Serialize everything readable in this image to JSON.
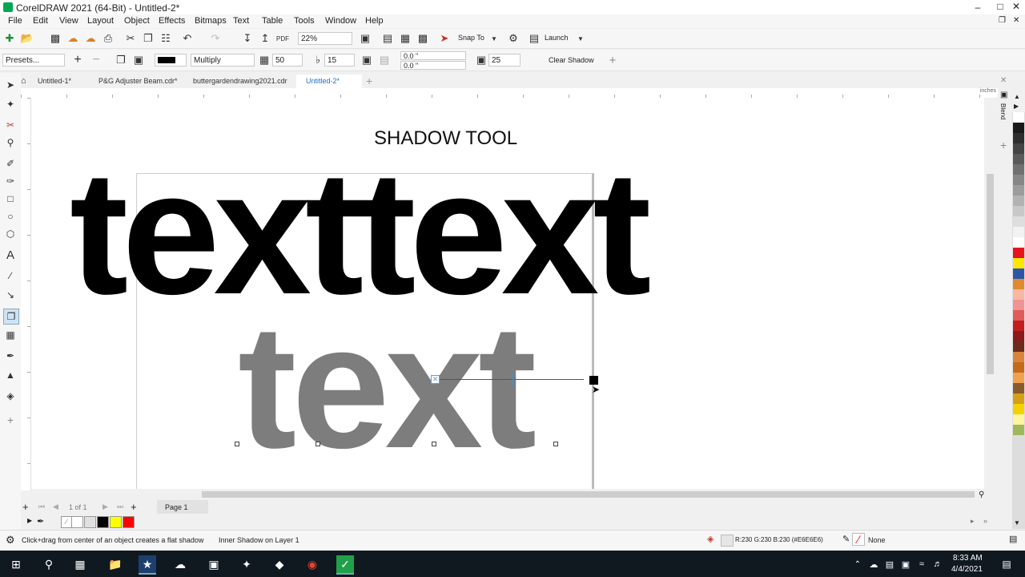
{
  "window": {
    "title": "CorelDRAW 2021 (64-Bit) - Untitled-2*"
  },
  "menu": [
    "File",
    "Edit",
    "View",
    "Layout",
    "Object",
    "Effects",
    "Bitmaps",
    "Text",
    "Table",
    "Tools",
    "Window",
    "Help"
  ],
  "standard_toolbar": {
    "zoom": "22%",
    "snap_to": "Snap To",
    "launch": "Launch"
  },
  "property_bar": {
    "presets": "Presets...",
    "merge_mode": "Multiply",
    "opacity": "50",
    "feather": "15",
    "offset_x": "0.0 \"",
    "offset_y": "0.0 \"",
    "shadow_stretch": "25",
    "clear_shadow": "Clear Shadow"
  },
  "doc_tabs": [
    "Untitled-1*",
    "P&G Adjuster Beam.cdr*",
    "buttergardendrawing2021.cdr",
    "Untitled-2*"
  ],
  "active_tab": "Untitled-2*",
  "ruler": {
    "unit": "inches"
  },
  "canvas": {
    "heading": "SHADOW TOOL",
    "word_line_1": "texttext",
    "word_line_2": "text",
    "text_color": "#000000",
    "shadow_color": "#7d7d7d"
  },
  "right_dock": {
    "label": "Blend"
  },
  "page_nav": {
    "page_count": "1 of 1",
    "page_tab": "Page 1"
  },
  "status": {
    "hint": "Click+drag from center of an object creates a flat shadow",
    "object_info": "Inner Shadow on Layer 1",
    "fill_info": "R:230 G:230 B:230 (#E6E6E6)",
    "outline_info": "None"
  },
  "taskbar": {
    "time": "8:33 AM",
    "date": "4/4/2021"
  },
  "palette_colors": [
    "#ffffff",
    "#1a1a1a",
    "#2e2e2e",
    "#444444",
    "#5a5a5a",
    "#707070",
    "#868686",
    "#9c9c9c",
    "#b2b2b2",
    "#c8c8c8",
    "#dedede",
    "#f2f2f2",
    "#ffffff",
    "#e8141b",
    "#ffe600",
    "#2f56a6",
    "#e08a2e",
    "#f7b7a3",
    "#f29393",
    "#e05a5a",
    "#c21e1e",
    "#8c1a1a",
    "#6b2c1e",
    "#d9843a",
    "#c46a1b",
    "#f0a14d",
    "#8a5a2a",
    "#d4a017",
    "#f5d000",
    "#fff4a0",
    "#9db85c"
  ],
  "swatch_colors": [
    "#ffffff",
    "#e0e0e0",
    "#000000",
    "#ffff00",
    "#ff0000"
  ]
}
